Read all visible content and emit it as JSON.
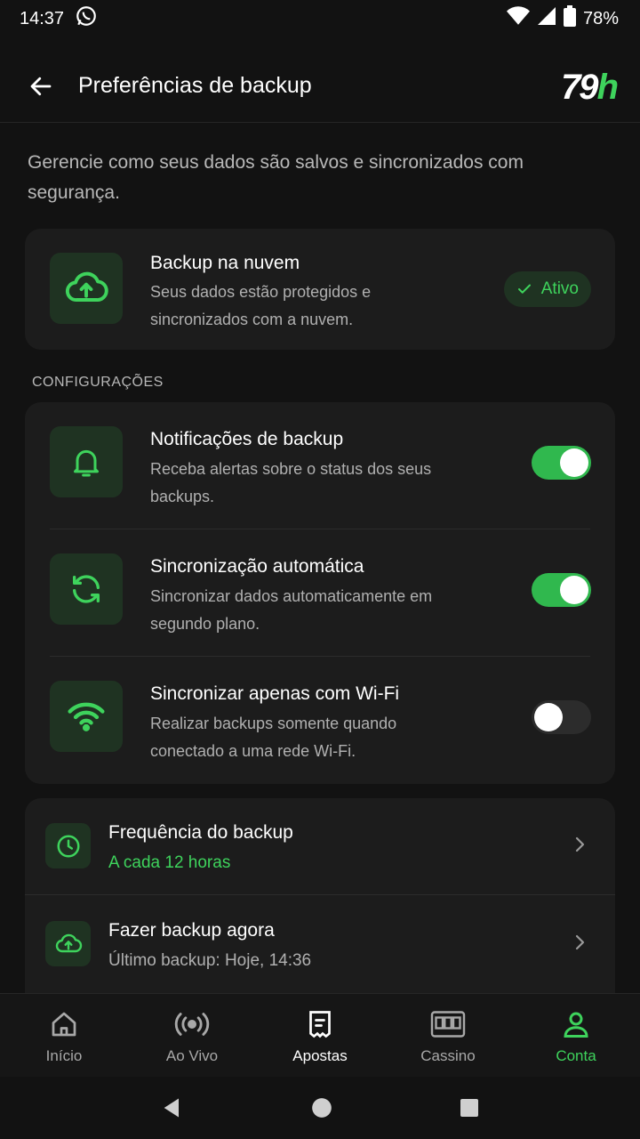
{
  "status_bar": {
    "time": "14:37",
    "battery": "78%"
  },
  "header": {
    "title": "Preferências de backup",
    "logo_text": "79",
    "logo_accent": "h"
  },
  "intro": "Gerencie como seus dados são salvos e sincronizados com segurança.",
  "cloud_backup": {
    "title": "Backup na nuvem",
    "description": "Seus dados estão protegidos e sincronizados com a nuvem.",
    "status": "Ativo"
  },
  "section_label": "CONFIGURAÇÕES",
  "settings": [
    {
      "title": "Notificações de backup",
      "description": "Receba alertas sobre o status dos seus backups.",
      "icon": "bell-icon",
      "enabled": true
    },
    {
      "title": "Sincronização automática",
      "description": "Sincronizar dados automaticamente em segundo plano.",
      "icon": "sync-icon",
      "enabled": true
    },
    {
      "title": "Sincronizar apenas com Wi-Fi",
      "description": "Realizar backups somente quando conectado a uma rede Wi-Fi.",
      "icon": "wifi-icon",
      "enabled": false
    }
  ],
  "actions": [
    {
      "title": "Frequência do backup",
      "subtitle": "A cada 12 horas",
      "icon": "clock-icon"
    },
    {
      "title": "Fazer backup agora",
      "subtitle": "Último backup: Hoje, 14:36",
      "icon": "cloud-upload-icon"
    }
  ],
  "bottom_nav": [
    {
      "label": "Início",
      "icon": "home-icon"
    },
    {
      "label": "Ao Vivo",
      "icon": "live-icon"
    },
    {
      "label": "Apostas",
      "icon": "bet-slip-icon"
    },
    {
      "label": "Cassino",
      "icon": "slot-machine-icon"
    },
    {
      "label": "Conta",
      "icon": "user-icon",
      "selected": true
    }
  ],
  "colors": {
    "accent": "#3ed35c",
    "background": "#121212",
    "card": "#1c1c1c",
    "icon_tile": "#1f3322"
  }
}
